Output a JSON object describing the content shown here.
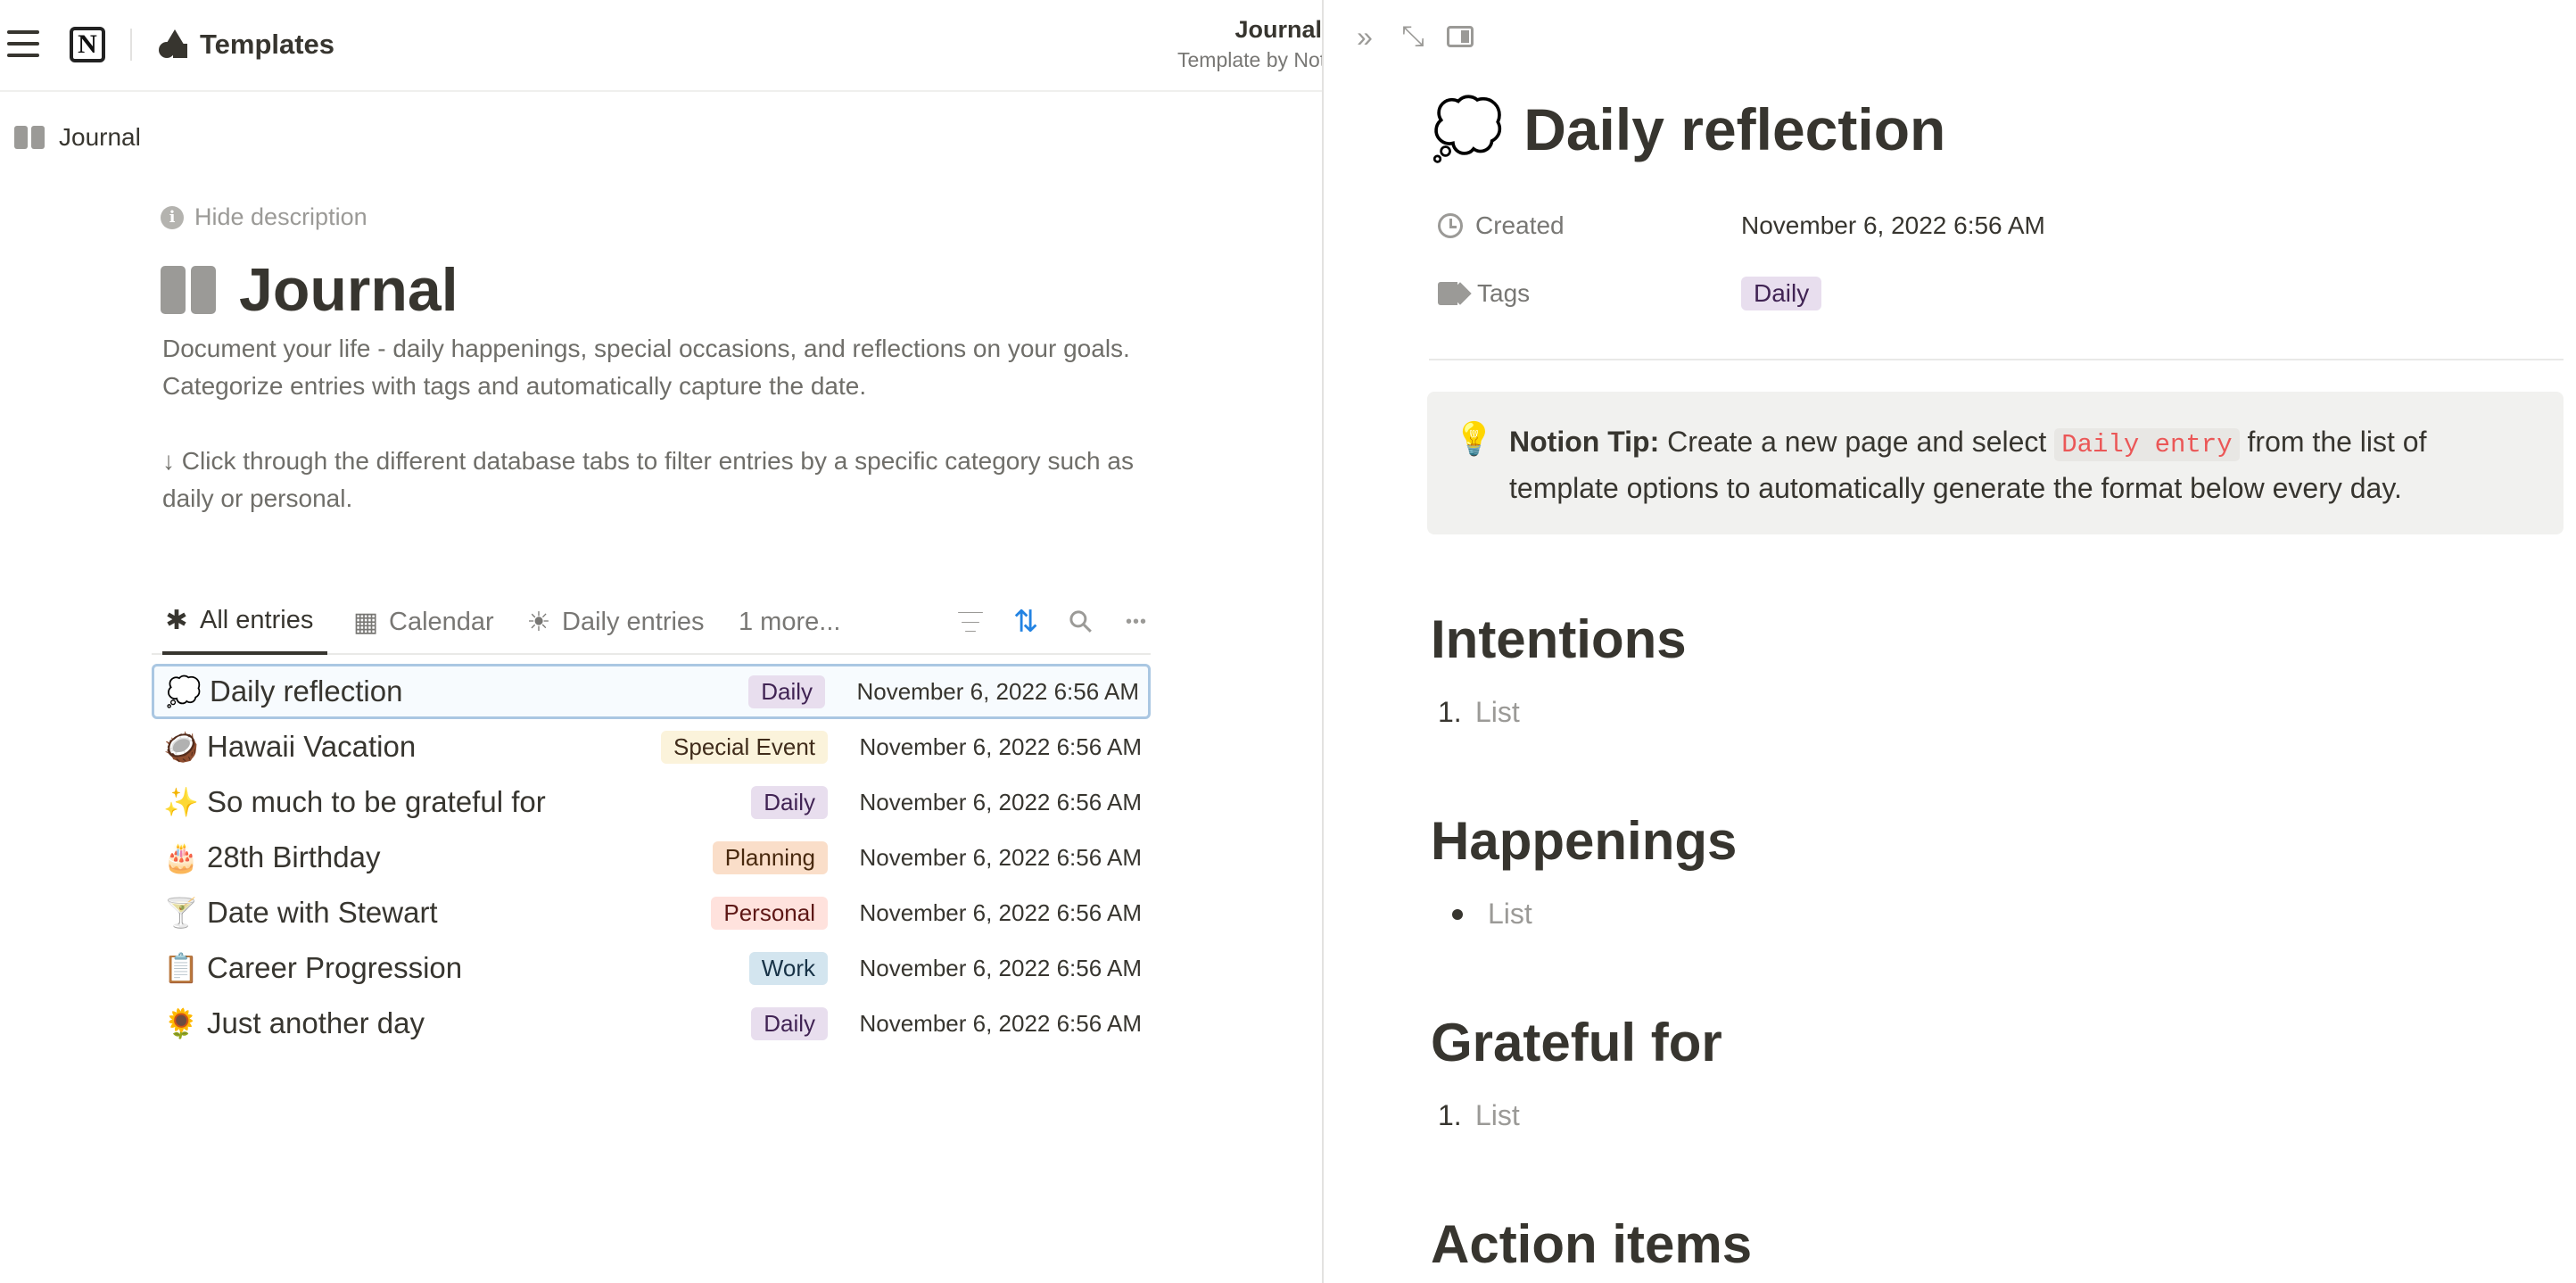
{
  "topbar": {
    "logo_letter": "N",
    "breadcrumb_title": "Templates",
    "center_title": "Journal",
    "center_subtitle": "Template by Notion"
  },
  "breadcrumb": {
    "label": "Journal"
  },
  "page": {
    "hide_description": "Hide description",
    "info_glyph": "i",
    "title": "Journal",
    "description_lines": [
      "Document your life - daily happenings, special occasions, and reflections on your goals.",
      "Categorize entries with tags and automatically capture the date.",
      "↓ Click through the different database tabs to filter entries by a specific category such as daily or personal."
    ]
  },
  "tabs": [
    {
      "label": "All entries",
      "icon": "✱",
      "icon_name": "asterisk-icon",
      "active": true
    },
    {
      "label": "Calendar",
      "icon": "▦",
      "icon_name": "calendar-icon",
      "active": false
    },
    {
      "label": "Daily entries",
      "icon": "☀",
      "icon_name": "sun-icon",
      "active": false
    },
    {
      "label": "1 more...",
      "icon": "",
      "icon_name": "",
      "active": false
    }
  ],
  "tools": {
    "sort_glyph": "⇅",
    "search_glyph": "⚲",
    "more_glyph": "•••"
  },
  "rows": [
    {
      "emoji": "💭",
      "name": "Daily reflection",
      "tag": "Daily",
      "date": "November 6, 2022 6:56 AM"
    },
    {
      "emoji": "🥥",
      "name": "Hawaii Vacation",
      "tag": "Special Event",
      "date": "November 6, 2022 6:56 AM"
    },
    {
      "emoji": "✨",
      "name": "So much to be grateful for",
      "tag": "Daily",
      "date": "November 6, 2022 6:56 AM"
    },
    {
      "emoji": "🎂",
      "name": "28th Birthday",
      "tag": "Planning",
      "date": "November 6, 2022 6:56 AM"
    },
    {
      "emoji": "🍸",
      "name": "Date with Stewart",
      "tag": "Personal",
      "date": "November 6, 2022 6:56 AM"
    },
    {
      "emoji": "📋",
      "name": "Career Progression",
      "tag": "Work",
      "date": "November 6, 2022 6:56 AM"
    },
    {
      "emoji": "🌻",
      "name": "Just another day",
      "tag": "Daily",
      "date": "November 6, 2022 6:56 AM"
    }
  ],
  "tag_colors": {
    "Daily": {
      "bg": "#e8deee",
      "fg": "#412454"
    },
    "Special Event": {
      "bg": "#fbf3db",
      "fg": "#402c1b"
    },
    "Planning": {
      "bg": "#fadec9",
      "fg": "#49290e"
    },
    "Personal": {
      "bg": "#ffe2dd",
      "fg": "#5d1715"
    },
    "Work": {
      "bg": "#d3e5ef",
      "fg": "#183347"
    }
  },
  "peek": {
    "tools": {
      "collapse_glyph": "»",
      "expand_glyph": "⤡"
    },
    "emoji": "💭",
    "title": "Daily reflection",
    "props": {
      "created_label": "Created",
      "created_value": "November 6, 2022 6:56 AM",
      "tags_label": "Tags",
      "tags_value": "Daily"
    },
    "callout": {
      "emoji": "💡",
      "bold": "Notion Tip:",
      "text_before": " Create a new page and select ",
      "code": "Daily entry",
      "text_after": " from the list of template options to automatically generate the format below every day."
    },
    "sections": [
      {
        "heading": "Intentions",
        "marker": "1.",
        "item": "List"
      },
      {
        "heading": "Happenings",
        "marker": "•",
        "item": "List"
      },
      {
        "heading": "Grateful for",
        "marker": "1.",
        "item": "List"
      },
      {
        "heading": "Action items",
        "marker": "",
        "item": ""
      }
    ]
  }
}
